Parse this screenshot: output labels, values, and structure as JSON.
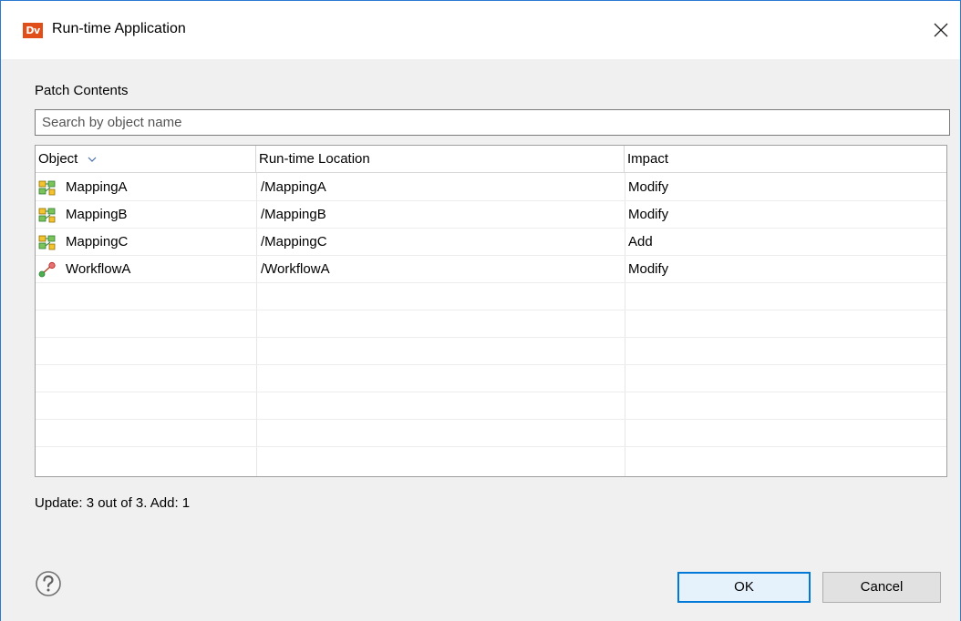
{
  "window": {
    "app_icon_text": "Dv",
    "title": "Run-time Application"
  },
  "section": {
    "label": "Patch Contents"
  },
  "search": {
    "placeholder": "Search by object name",
    "value": ""
  },
  "table": {
    "columns": [
      "Object",
      "Run-time Location",
      "Impact"
    ],
    "sorted_column": "Object",
    "rows": [
      {
        "icon": "mapping-icon",
        "object": "MappingA",
        "location": "/MappingA",
        "impact": "Modify"
      },
      {
        "icon": "mapping-icon",
        "object": "MappingB",
        "location": "/MappingB",
        "impact": "Modify"
      },
      {
        "icon": "mapping-icon",
        "object": "MappingC",
        "location": "/MappingC",
        "impact": "Add"
      },
      {
        "icon": "workflow-icon",
        "object": "WorkflowA",
        "location": "/WorkflowA",
        "impact": "Modify"
      }
    ]
  },
  "status": {
    "text": "Update: 3 out of 3.  Add: 1"
  },
  "footer": {
    "ok_label": "OK",
    "cancel_label": "Cancel"
  },
  "colors": {
    "accent": "#0078d7",
    "app_icon": "#e04e1a",
    "window_border": "#2b79d0"
  }
}
